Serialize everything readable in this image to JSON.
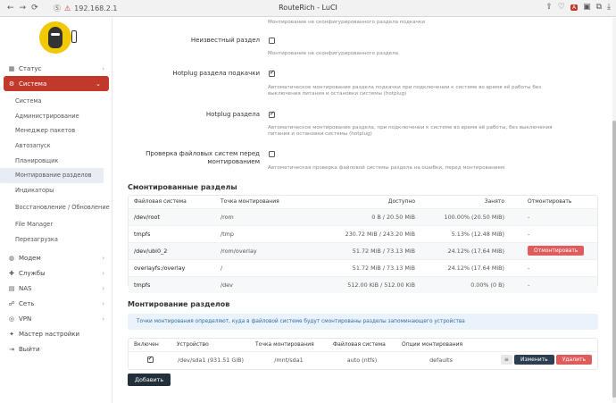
{
  "browser": {
    "url": "192.168.2.1",
    "title": "RouteRich - LuCI",
    "warning_icon": "warning-icon"
  },
  "sidebar": {
    "items": [
      {
        "label": "Статус",
        "icon": "dashboard-icon"
      },
      {
        "label": "Система",
        "icon": "gear-icon"
      },
      {
        "label": "Модем",
        "icon": "globe-icon"
      },
      {
        "label": "Службы",
        "icon": "puzzle-icon"
      },
      {
        "label": "NAS",
        "icon": "storage-icon"
      },
      {
        "label": "Сеть",
        "icon": "network-icon"
      },
      {
        "label": "VPN",
        "icon": "vpn-icon"
      },
      {
        "label": "Мастер настройки",
        "icon": "wizard-icon"
      },
      {
        "label": "Выйти",
        "icon": "logout-icon"
      }
    ],
    "system_sub": [
      "Система",
      "Администрирование",
      "Менеджер пакетов",
      "Автозапуск",
      "Планировщик",
      "Монтирование разделов",
      "Индикаторы",
      "Восстановление / Обновление",
      "File Manager",
      "Перезагрузка"
    ]
  },
  "options": {
    "top_hint": "Монтирование не сконфигурированного раздела подкачки",
    "unknown_label": "Неизвестный раздел",
    "unknown_hint": "Монтирование не сконфигурированного раздела",
    "hotplug_swap_label": "Hotplug раздела подкачки",
    "hotplug_swap_hint": "Автоматическое монтирование раздела подкачки при подключении к системе во время её работы без выключения питания и остановки системы (hotplug)",
    "hotplug_part_label": "Hotplug раздела",
    "hotplug_part_hint": "Автоматическое монтирование раздела, при подключении к системе во время её работы, без выключения питания и остановки системы (hotplug)",
    "fscheck_label": "Проверка файловых систем перед монтированием",
    "fscheck_hint": "Автоматическая проверка файловой системы раздела на ошибки, перед монтированием"
  },
  "mounted": {
    "title": "Смонтированные разделы",
    "headers": [
      "Файловая система",
      "Точка монтирования",
      "Доступно",
      "Занято",
      "Отмонтировать"
    ],
    "rows": [
      {
        "fs": "/dev/root",
        "mount": "/rom",
        "avail": "0 B / 20.50 MiB",
        "used": "100.00% (20.50 MiB)",
        "action": "-"
      },
      {
        "fs": "tmpfs",
        "mount": "/tmp",
        "avail": "230.72 MiB / 243.20 MiB",
        "used": "5.13% (12.48 MiB)",
        "action": "-"
      },
      {
        "fs": "/dev/ubi0_2",
        "mount": "/rom/overlay",
        "avail": "51.72 MiB / 73.13 MiB",
        "used": "24.12% (17.64 MiB)",
        "action": "Отмонтировать"
      },
      {
        "fs": "overlayfs:/overlay",
        "mount": "/",
        "avail": "51.72 MiB / 73.13 MiB",
        "used": "24.12% (17.64 MiB)",
        "action": "-"
      },
      {
        "fs": "tmpfs",
        "mount": "/dev",
        "avail": "512.00 KiB / 512.00 KiB",
        "used": "0.00% (0 B)",
        "action": "-"
      }
    ]
  },
  "mounts": {
    "title": "Монтирование разделов",
    "info": "Точки монтирования определяют, куда в файловой системе будут смонтированы разделы запоминающего устройства",
    "headers": [
      "Включен",
      "Устройство",
      "Точка монтирования",
      "Файловая система",
      "Опции монтирования"
    ],
    "rows": [
      {
        "device": "/dev/sda1 (931.51 GiB)",
        "mount": "/mnt/sda1",
        "fs": "auto (ntfs)",
        "options": "defaults",
        "enabled": true
      }
    ],
    "edit_label": "Изменить",
    "delete_label": "Удалить",
    "drag_label": "≡",
    "add_label": "Добавить"
  }
}
